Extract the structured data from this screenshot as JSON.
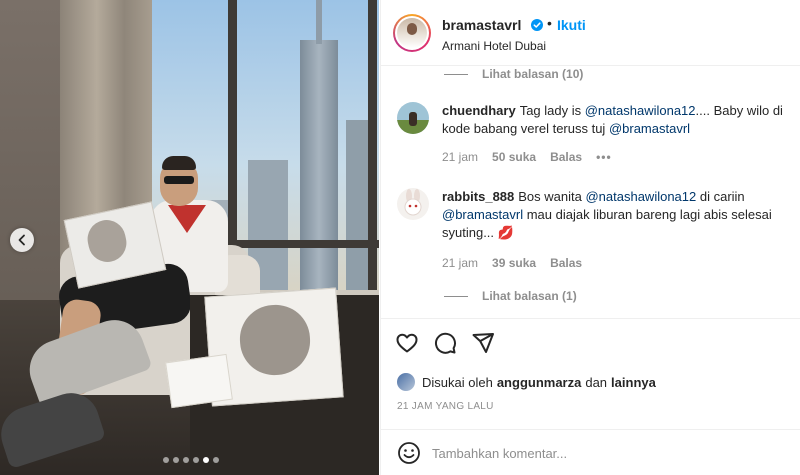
{
  "media": {
    "prev_icon": "chevron-left-icon",
    "slide_count": 6,
    "active_slide": 5
  },
  "header": {
    "username": "bramastavrl",
    "verified_icon": "verified-badge-icon",
    "separator": "•",
    "follow_label": "Ikuti",
    "location": "Armani Hotel Dubai"
  },
  "comments": {
    "top_view_replies": "Lihat balasan (10)",
    "items": [
      {
        "user": "chuendhary",
        "text_pre": "Tag lady is ",
        "mention1": "@natashawilona12",
        "text_mid": ".... Baby wilo di kode babang verel teruss tuj ",
        "mention2": "@bramastavrl",
        "text_post": "",
        "time": "21 jam",
        "likes": "50 suka",
        "reply": "Balas",
        "more": "•••"
      },
      {
        "user": "rabbits_888",
        "text_pre": "Bos wanita ",
        "mention1": "@natashawilona12",
        "text_mid": " di cariin ",
        "mention2": "@bramastavrl",
        "text_post": " mau diajak liburan bareng lagi abis selesai syuting... 💋",
        "time": "21 jam",
        "likes": "39 suka",
        "reply": "Balas"
      }
    ],
    "bottom_view_replies": "Lihat balasan (1)"
  },
  "actions": {
    "like_icon": "heart-icon",
    "comment_icon": "comment-bubble-icon",
    "share_icon": "send-icon",
    "liked_prefix": "Disukai oleh",
    "liked_user": "anggunmarza",
    "liked_and": "dan",
    "liked_others": "lainnya",
    "timestamp": "21 JAM YANG LALU"
  },
  "add_comment": {
    "emoji_icon": "emoji-smile-icon",
    "placeholder": "Tambahkan komentar..."
  },
  "colors": {
    "accent_blue": "#0095f6",
    "mention": "#00376b",
    "secondary_text": "#8e8e8e"
  }
}
